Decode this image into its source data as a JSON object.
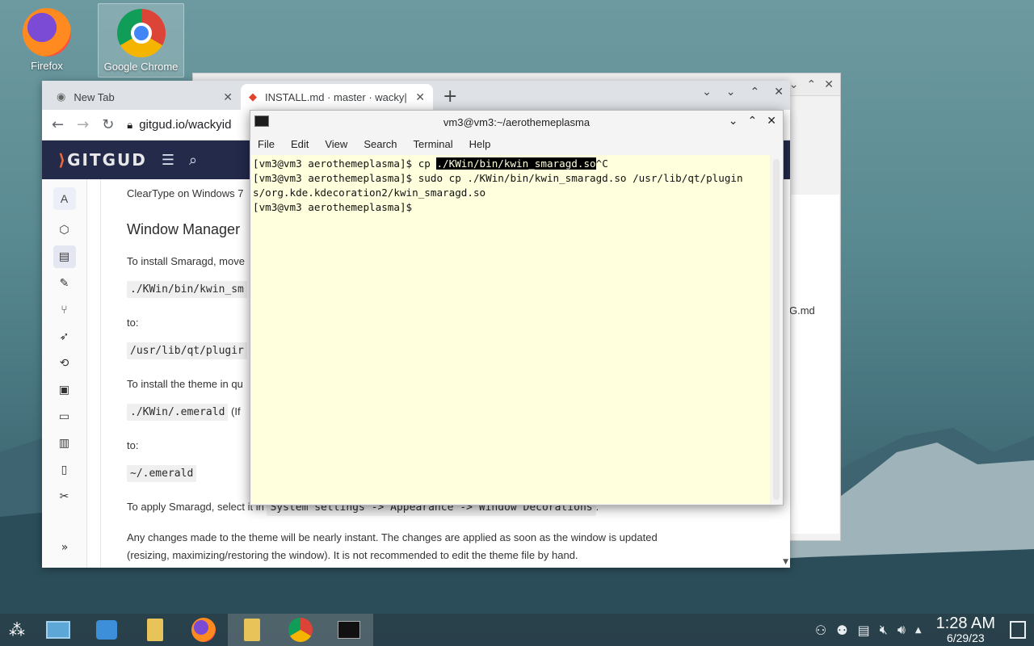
{
  "desktop": {
    "icons": [
      {
        "label": "Firefox"
      },
      {
        "label": "Google Chrome"
      }
    ]
  },
  "back_window": {
    "file_label": "G.md"
  },
  "browser": {
    "tabs": [
      {
        "title": "New Tab"
      },
      {
        "title": "INSTALL.md · master · wacky|"
      }
    ],
    "url": "gitgud.io/wackyid",
    "site_logo": "GITGUD",
    "sidebar_letter": "A",
    "doc": {
      "line0": "ClearType on Windows 7",
      "heading": "Window Manager",
      "p1": "To install Smaragd, move",
      "code1": "./KWin/bin/kwin_sm",
      "to1": "to:",
      "code2": "/usr/lib/qt/plugir",
      "p2": "To install the theme in qu",
      "code3": "./KWin/.emerald",
      "code3_after": "(If",
      "to2": "to:",
      "code4": "~/.emerald",
      "p3": "To apply Smaragd, select it in",
      "p3_code": "System settings -> Appearance -> Window Decorations",
      "p3_end": ".",
      "p4a": "Any changes made to the theme will be nearly instant. The changes are applied as soon as the window is updated",
      "p4b": "(resizing, maximizing/restoring the window). It is not recommended to edit the theme file by hand."
    }
  },
  "terminal": {
    "title": "vm3@vm3:~/aerothemeplasma",
    "menu": [
      "File",
      "Edit",
      "View",
      "Search",
      "Terminal",
      "Help"
    ],
    "lines": {
      "l1_prompt": "[vm3@vm3 aerothemeplasma]$ cp ",
      "l1_selected": "./KWin/bin/kwin_smaragd.so",
      "l1_tail": "^C",
      "l2": "[vm3@vm3 aerothemeplasma]$ sudo cp ./KWin/bin/kwin_smaragd.so /usr/lib/qt/plugin",
      "l3": "s/org.kde.kdecoration2/kwin_smaragd.so",
      "l4": "[vm3@vm3 aerothemeplasma]$ "
    }
  },
  "taskbar": {
    "time": "1:28 AM",
    "date": "6/29/23"
  }
}
